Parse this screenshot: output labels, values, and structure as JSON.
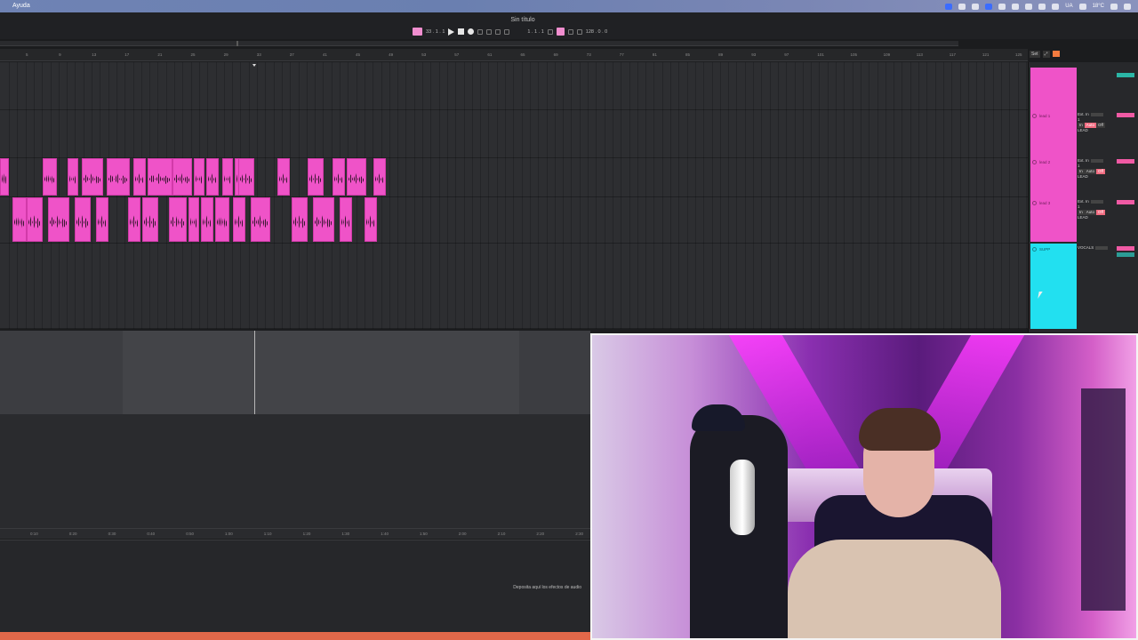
{
  "menubar": {
    "menu_item": "Ayuda",
    "status_text_lang": "UA",
    "status_text_temp": "18°C"
  },
  "control_bar": {
    "document_title": "Sin título",
    "position": "33 . 1 . 1",
    "loop_start": "1 . 1 . 1",
    "tempo": "128 . 0 . 0"
  },
  "ruler": {
    "bars": [
      "5",
      "9",
      "13",
      "17",
      "21",
      "25",
      "29",
      "33",
      "37",
      "41",
      "45",
      "49",
      "53",
      "57",
      "61",
      "65",
      "69",
      "73",
      "77",
      "81",
      "85",
      "89",
      "93",
      "97",
      "101",
      "105",
      "109",
      "113",
      "117",
      "121",
      "125"
    ],
    "set_label": "Set"
  },
  "time_ruler": {
    "labels": [
      "0:10",
      "0:20",
      "0:30",
      "0:40",
      "0:50",
      "1:00",
      "1:10",
      "1:20",
      "1:30",
      "1:40",
      "1:50",
      "2:00",
      "2:10",
      "2:20",
      "2:30"
    ]
  },
  "tracks": [
    {
      "name": "lead 1",
      "input": "Ext. In",
      "channel": "1",
      "monitor": [
        "In",
        "Auto",
        "Off"
      ],
      "output": "LEAD",
      "number": "1"
    },
    {
      "name": "lead 2",
      "input": "Ext. In",
      "channel": "1",
      "monitor": [
        "In",
        "Auto",
        "Off"
      ],
      "output": "LEAD",
      "number": "2"
    },
    {
      "name": "lead 3",
      "input": "Ext. In",
      "channel": "1",
      "monitor": [
        "In",
        "Auto",
        "Off"
      ],
      "output": "LEAD",
      "number": "3"
    },
    {
      "name": "SUPP",
      "input": "VOCALS",
      "channel": "",
      "monitor": [],
      "output": "",
      "number": "4"
    }
  ],
  "device_area": {
    "drop_hint": "Deposita aquí los efectos de audio"
  },
  "colors": {
    "clip_pink": "#ef53c8",
    "track_cyan": "#22e0f0",
    "accent_orange": "#e2684a"
  }
}
